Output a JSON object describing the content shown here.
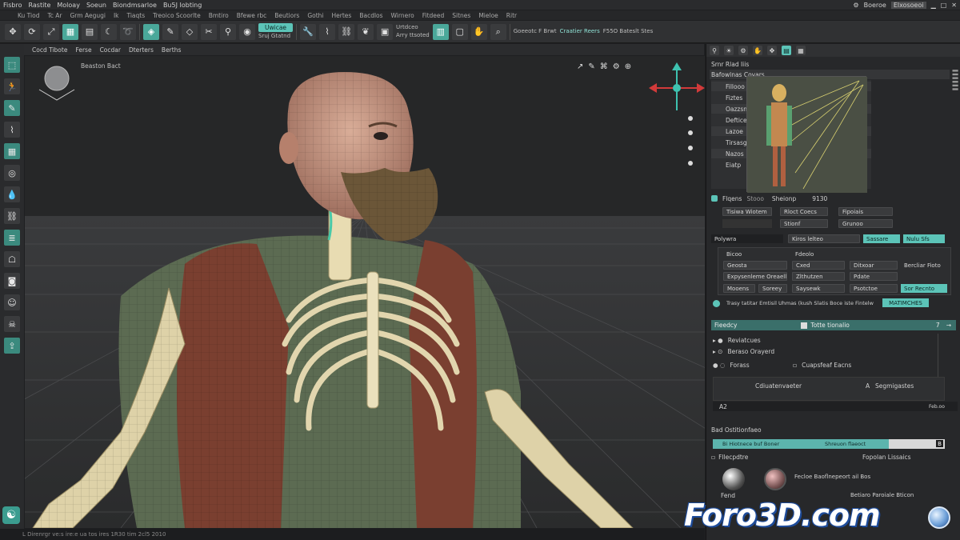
{
  "menu": {
    "items": [
      "Fisbro",
      "Rastite",
      "Moloay",
      "Soeun",
      "Biondmsarloe",
      "Bu5J Iobting"
    ],
    "right": [
      "Boeroe",
      "Elxosoeoi"
    ]
  },
  "tabbar": {
    "items": [
      "Ku Tiod",
      "Tc Ar",
      "Grm Aegugi",
      "Ik",
      "Tiaqts",
      "Treoico Scoorlte",
      "Bmtiro",
      "Bfewe rbc",
      "Beutiors",
      "Gothi",
      "Hertes",
      "Bacdlos",
      "Wirnero",
      "Fitdeed",
      "Sitnes",
      "Mieloe",
      "Ritr"
    ]
  },
  "toolbar": {
    "pill": "Uwicae",
    "txt1": "Sruj Gtatnd",
    "txt2": "Urtdceo",
    "txt3": "Arry ttsoted",
    "right1": "Goeeotc F Brwt",
    "right2": "Craatier Reers",
    "right3": "F55O Bateslt Stes"
  },
  "subbar": {
    "items": [
      "Cocd Tibote",
      "Ferse",
      "Cocdar",
      "Dterters",
      "Berths"
    ]
  },
  "viewport": {
    "label": "Beaston Bact"
  },
  "statusbar": {
    "text": "L  Direnrgr ve:s  ire:e  ua tos  ires  1R30  tim    2cl5  2010"
  },
  "panel": {
    "header_title": "Srnr Rlad Iiis",
    "outliner_title": "Bafowlnas Covars",
    "layers": [
      "Fillooo",
      "Fiztes",
      "Oazzsn",
      "Deftice",
      "Lazoe",
      "Tirsasg",
      "Nazos",
      "Eiatp"
    ],
    "props_row": {
      "a": "Flqens",
      "b": "Stooo",
      "c": "Sheionp",
      "d": "9130"
    },
    "fields1": [
      {
        "label": "Tisiwa Wiotem",
        "value": "Rloct Coecs"
      },
      {
        "label": "",
        "value": "Stionf"
      },
      {
        "label": "",
        "value": "Fipoiais"
      },
      {
        "label": "",
        "value": "Grunoo"
      }
    ],
    "filter": {
      "label": "Polywra",
      "opt1": "Kiros lelteo",
      "opt2": "Sassare",
      "opt3": "Nulu Sfs"
    },
    "table": [
      [
        "Bicoo",
        "Fdeolo",
        "",
        ""
      ],
      [
        "Geosta",
        "Cxed",
        "Ditxoar",
        "Bercliar Fioto"
      ],
      [
        "Expysenleme Oreaell",
        "Zlthutzen",
        "Pdate",
        ""
      ],
      [
        "Mooens",
        "Soreey",
        "Saysewk",
        "Psotctoe",
        "Sor Recnto"
      ]
    ],
    "info_text": "Trasy tatitar Emtisil Uhmas (kush Slatis Boce iste Fintelw",
    "info_button": "MATIMCHES",
    "section1": {
      "label": "Fieedcy",
      "value": "Totte tionalio",
      "num": "7",
      "sym": "→"
    },
    "tree": [
      "Reviatcues",
      "Beraso Orayerd",
      "Forass",
      "Cuapsfeaf Eacns"
    ],
    "tree_foot": {
      "left": "Cdiuatenvaeter",
      "right": "Segmigastes"
    },
    "az_label": "A2",
    "az_right": "Feb.oo",
    "section2": "Bad Ostitionfaeo",
    "slider": {
      "left": "Bi Hiotnece buf Boner",
      "right": "Shreuon flaeoct"
    },
    "materials": {
      "left": "Fllecpdtre",
      "right": "Fopolan Lissaics"
    },
    "mat_btn": "Fecloe Baoflnepeort ail Bos",
    "card": "Fend",
    "card_right": "Betiaro Paroiale Bticon"
  },
  "watermark": "Foro3D.com"
}
